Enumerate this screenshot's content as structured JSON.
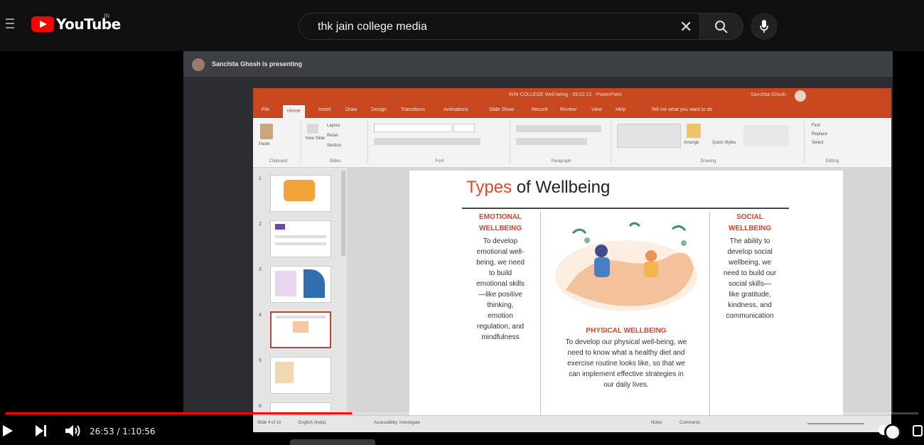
{
  "youtube": {
    "logo_text": "YouTube",
    "country_code": "IN",
    "search_query": "thk jain college media"
  },
  "meet": {
    "presenter_text": "Sanchita Ghosh is presenting"
  },
  "ppt": {
    "title": "WIN COLLEGE Well being - 09.02.22 - PowerPoint",
    "user": "Sanchita Ghosh",
    "tabs": [
      "File",
      "Home",
      "Insert",
      "Draw",
      "Design",
      "Transitions",
      "Animations",
      "Slide Show",
      "Record",
      "Review",
      "View",
      "Help",
      "Tell me what you want to do"
    ],
    "ribbon_groups": [
      "Clipboard",
      "Slides",
      "Font",
      "Paragraph",
      "Drawing",
      "Editing"
    ],
    "ribbon_buttons": {
      "paste": "Paste",
      "new_slide": "New Slide",
      "layout": "Layout",
      "reset": "Reset",
      "section": "Section",
      "arrange": "Arrange",
      "quick_styles": "Quick Styles",
      "find": "Find",
      "replace": "Replace",
      "select": "Select"
    },
    "thumb_numbers": [
      "1",
      "2",
      "3",
      "4",
      "5",
      "6"
    ],
    "status_left": "Slide 4 of 10",
    "status_lang": "English (India)",
    "status_access": "Accessibility: Investigate",
    "status_notes": "Notes",
    "status_comments": "Comments"
  },
  "slide": {
    "title_accent": "Types",
    "title_rest": " of Wellbeing",
    "emotional_head": [
      "EMOTIONAL",
      "WELLBEING"
    ],
    "emotional_body": [
      "To develop",
      "emotional well-",
      "being, we need",
      "to build",
      "emotional skills",
      "—like positive",
      "thinking,",
      "emotion",
      "regulation, and",
      "mindfulness"
    ],
    "social_head": [
      "SOCIAL",
      "WELLBEING"
    ],
    "social_body": [
      "The ability to",
      "develop social",
      "wellbeing, we",
      "need to build our",
      "social skills—",
      "like gratitude,",
      "kindness, and",
      "communication"
    ],
    "physical_head": "PHYSICAL WELLBEING",
    "physical_body": [
      "To develop our physical well-being, we",
      "need to know what a healthy diet and",
      "exercise routine looks like, so that we",
      "can implement effective strategies in",
      "our daily lives."
    ]
  },
  "player": {
    "current_time": "26:53",
    "duration": "1:10:56",
    "time_display": "26:53 / 1:10:56",
    "progress_fraction": 0.379,
    "autoplay": true
  },
  "colors": {
    "youtube_red": "#ff0000",
    "ppt_orange": "#c7471f",
    "slide_accent": "#e24a2a"
  }
}
